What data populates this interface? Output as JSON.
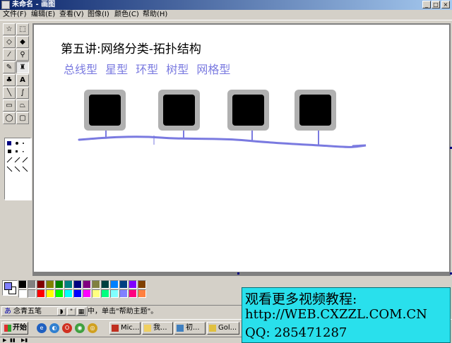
{
  "window": {
    "title": "未命名 - 画图",
    "minimize_glyph": "_",
    "maximize_glyph": "□",
    "close_glyph": "×"
  },
  "menu": {
    "items": [
      "文件(F)",
      "编辑(E)",
      "查看(V)",
      "图像(I)",
      "颜色(C)",
      "帮助(H)"
    ]
  },
  "tools": {
    "items": [
      {
        "name": "free-select",
        "glyph": "☆"
      },
      {
        "name": "rect-select",
        "glyph": "⬚"
      },
      {
        "name": "eraser",
        "glyph": "◇"
      },
      {
        "name": "fill",
        "glyph": "◆"
      },
      {
        "name": "color-picker",
        "glyph": "⁄"
      },
      {
        "name": "magnifier",
        "glyph": "⚲"
      },
      {
        "name": "pencil",
        "glyph": "✎"
      },
      {
        "name": "brush",
        "glyph": "♜"
      },
      {
        "name": "airbrush",
        "glyph": "♣"
      },
      {
        "name": "text",
        "glyph": "A"
      },
      {
        "name": "line",
        "glyph": "╲"
      },
      {
        "name": "curve",
        "glyph": "∫"
      },
      {
        "name": "rectangle",
        "glyph": "▭"
      },
      {
        "name": "polygon",
        "glyph": "⏢"
      },
      {
        "name": "ellipse",
        "glyph": "◯"
      },
      {
        "name": "rounded-rect",
        "glyph": "▢"
      }
    ],
    "active": "brush"
  },
  "canvas": {
    "heading": "第五讲:网络分类-拓扑结构",
    "types": "总线型 星型 环型 树型 网格型",
    "line_color": "#7a7ae0",
    "node_fill": "#000000",
    "node_border": "#b0b0b0"
  },
  "palette": {
    "foreground": "#8080ff",
    "background": "#ffffff",
    "colors": [
      "#000000",
      "#808080",
      "#800000",
      "#808000",
      "#008000",
      "#008080",
      "#000080",
      "#800080",
      "#808040",
      "#004040",
      "#0080ff",
      "#004080",
      "#8000ff",
      "#804000",
      "#ffffff",
      "#c0c0c0",
      "#ff0000",
      "#ffff00",
      "#00ff00",
      "#00ffff",
      "#0000ff",
      "#ff00ff",
      "#ffff80",
      "#00ff80",
      "#80ffff",
      "#8080ff",
      "#ff0080",
      "#ff8040"
    ]
  },
  "status": {
    "ime_name": "念青五笔",
    "ime_sym1": "◗",
    "ime_sym2": "\"",
    "ime_sym3": "▦",
    "help_text": "中，单击\"帮助主题\"。"
  },
  "taskbar": {
    "start_label": "开始",
    "tasks": [
      "Mic...",
      "我...",
      "初...",
      "Gol..."
    ]
  },
  "watermark": {
    "line1": "观看更多视频教程:",
    "line2": "http://WEB.CXZZL.COM.CN",
    "line3": "QQ:  285471287"
  }
}
